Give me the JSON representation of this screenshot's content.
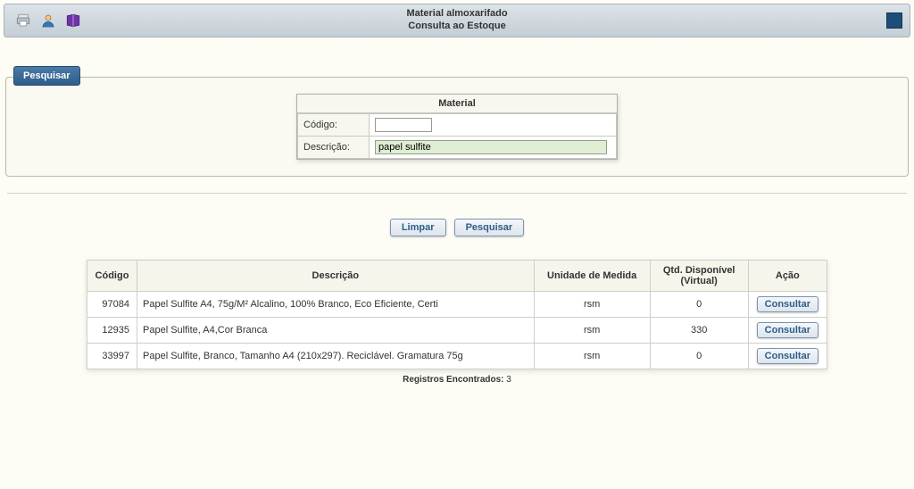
{
  "header": {
    "title": "Material almoxarifado",
    "subtitle": "Consulta ao Estoque"
  },
  "panel": {
    "tab_label": "Pesquisar",
    "material_label": "Material",
    "codigo_label": "Código:",
    "descricao_label": "Descrição:",
    "codigo_value": "",
    "descricao_value": "papel sulfite"
  },
  "buttons": {
    "limpar": "Limpar",
    "pesquisar": "Pesquisar",
    "consultar": "Consultar"
  },
  "table": {
    "headers": {
      "codigo": "Código",
      "descricao": "Descrição",
      "unidade": "Unidade de Medida",
      "qtd": "Qtd. Disponível (Virtual)",
      "acao": "Ação"
    },
    "rows": [
      {
        "codigo": "97084",
        "descricao": "Papel Sulfite A4, 75g/M² Alcalino, 100% Branco, Eco Eficiente, Certi",
        "unidade": "rsm",
        "qtd": "0"
      },
      {
        "codigo": "12935",
        "descricao": "Papel Sulfite, A4,Cor Branca",
        "unidade": "rsm",
        "qtd": "330"
      },
      {
        "codigo": "33997",
        "descricao": "Papel Sulfite, Branco, Tamanho A4 (210x297). Reciclável. Gramatura 75g",
        "unidade": "rsm",
        "qtd": "0"
      }
    ]
  },
  "footer": {
    "label": "Registros Encontrados:",
    "count": "3"
  }
}
